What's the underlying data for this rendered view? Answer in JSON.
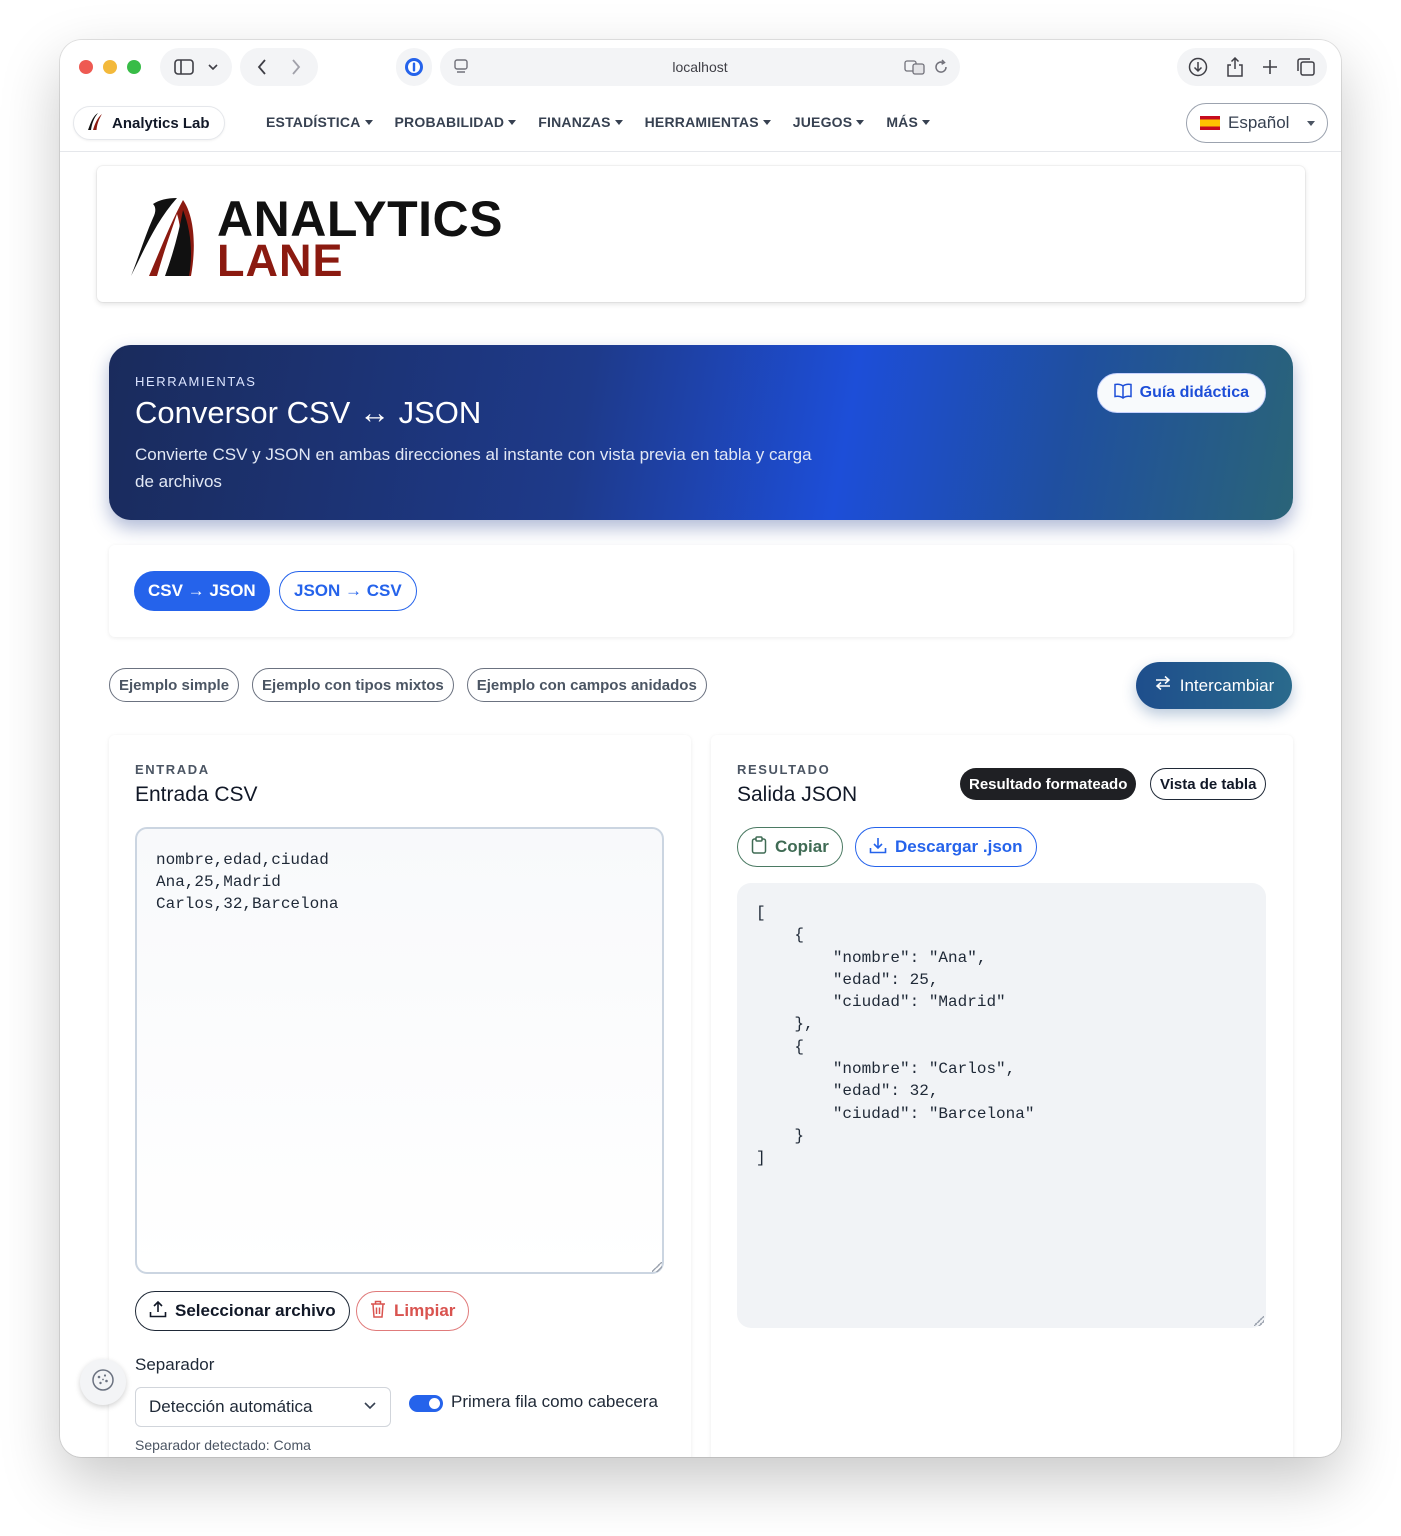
{
  "browser": {
    "url": "localhost"
  },
  "nav": {
    "brand": "Analytics Lab",
    "items": [
      {
        "label": "ESTADÍSTICA"
      },
      {
        "label": "PROBABILIDAD"
      },
      {
        "label": "FINANZAS"
      },
      {
        "label": "HERRAMIENTAS"
      },
      {
        "label": "JUEGOS"
      },
      {
        "label": "MÁS"
      }
    ],
    "language": "Español"
  },
  "logo": {
    "line1": "ANALYTICS",
    "line2": "LANE"
  },
  "hero": {
    "eyebrow": "HERRAMIENTAS",
    "title": "Conversor CSV ↔ JSON",
    "description": "Convierte CSV y JSON en ambas direcciones al instante con vista previa en tabla y carga de archivos",
    "guide_label": "Guía didáctica"
  },
  "modes": {
    "active": "CSV → JSON",
    "other": "JSON → CSV"
  },
  "examples": [
    {
      "label": "Ejemplo simple"
    },
    {
      "label": "Ejemplo con tipos mixtos"
    },
    {
      "label": "Ejemplo con campos anidados"
    }
  ],
  "swap_label": "Intercambiar",
  "input_panel": {
    "eyebrow": "ENTRADA",
    "title": "Entrada CSV",
    "value": "nombre,edad,ciudad\nAna,25,Madrid\nCarlos,32,Barcelona",
    "file_button": "Seleccionar archivo",
    "clear_button": "Limpiar",
    "separator_label": "Separador",
    "separator_value": "Detección automática",
    "header_toggle_label": "Primera fila como cabecera",
    "detected_text": "Separador detectado: Coma"
  },
  "output_panel": {
    "eyebrow": "RESULTADO",
    "title": "Salida JSON",
    "view_formatted": "Resultado formateado",
    "view_table": "Vista de tabla",
    "copy_button": "Copiar",
    "download_button": "Descargar .json",
    "value": "[\n    {\n        \"nombre\": \"Ana\",\n        \"edad\": 25,\n        \"ciudad\": \"Madrid\"\n    },\n    {\n        \"nombre\": \"Carlos\",\n        \"edad\": 32,\n        \"ciudad\": \"Barcelona\"\n    }\n]"
  },
  "colors": {
    "accent": "#2563eb",
    "hero_dark": "#1e3a8a",
    "danger": "#d9534f",
    "logo_red": "#8b1a10"
  }
}
